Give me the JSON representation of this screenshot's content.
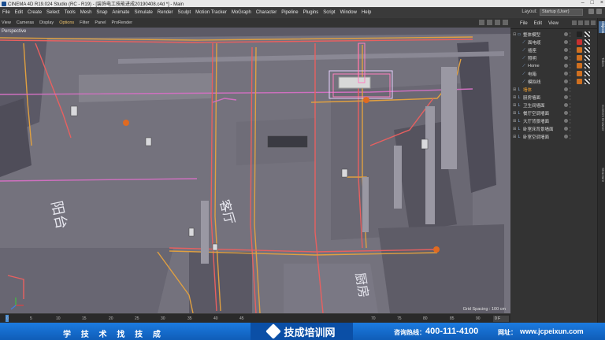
{
  "window": {
    "title": "CINEMA 4D R19.024 Studio (RC - R19) - [装饰电工技能进成20190408.c4d *] - Main"
  },
  "menubar": {
    "items": [
      "File",
      "Edit",
      "Create",
      "Select",
      "Tools",
      "Mesh",
      "Snap",
      "Animate",
      "Simulate",
      "Render",
      "Sculpt",
      "Motion Tracker",
      "MoGraph",
      "Character",
      "Pipeline",
      "Plugins",
      "Script",
      "Window",
      "Help"
    ],
    "layout_label": "Layout:",
    "layout_value": "Startup (User)"
  },
  "viewport_menu": {
    "items": [
      "View",
      "Cameras",
      "Display",
      "Options",
      "Filter",
      "Panel",
      "ProRender"
    ],
    "active": "Options"
  },
  "viewport": {
    "camera_label": "Perspective",
    "grid_spacing": "Grid Spacing : 100 cm",
    "room_labels": [
      "阳台",
      "客厅",
      "厨房"
    ]
  },
  "timeline": {
    "ticks": [
      "0",
      "5",
      "10",
      "15",
      "20",
      "25",
      "30",
      "35",
      "40",
      "45",
      "70",
      "75",
      "80",
      "85",
      "90"
    ],
    "frame": "0 F"
  },
  "object_manager": {
    "menu": [
      "File",
      "Edit",
      "View"
    ],
    "objects": [
      {
        "name": "整体模型",
        "indent": 0,
        "expand": "⊟",
        "icon": "layer-icon",
        "tag": "#222222",
        "tag2": "#e8e8e8"
      },
      {
        "name": "面电缆",
        "indent": 1,
        "expand": "",
        "icon": "spline-icon",
        "tag": "#c83030",
        "tag2": "#e8e8e8"
      },
      {
        "name": "插座",
        "indent": 1,
        "expand": "",
        "icon": "spline-icon",
        "tag": "#d07020",
        "tag2": "#e8e8e8"
      },
      {
        "name": "照明",
        "indent": 1,
        "expand": "",
        "icon": "spline-icon",
        "tag": "#d07020",
        "tag2": "#e8e8e8"
      },
      {
        "name": "Home",
        "indent": 1,
        "expand": "",
        "icon": "spline-icon",
        "tag": "#d07020",
        "tag2": "#e8e8e8"
      },
      {
        "name": "电箱",
        "indent": 1,
        "expand": "",
        "icon": "spline-icon",
        "tag": "#d07020",
        "tag2": "#e8e8e8"
      },
      {
        "name": "模拟线",
        "indent": 1,
        "expand": "",
        "icon": "spline-icon",
        "tag": "#d07020",
        "tag2": "#e8e8e8"
      },
      {
        "name": "墙体",
        "indent": 0,
        "expand": "⊞",
        "icon": "null-icon",
        "tag": "",
        "tag2": "",
        "highlight": true
      },
      {
        "name": "厨房墙面",
        "indent": 0,
        "expand": "⊞",
        "icon": "null-icon",
        "tag": "",
        "tag2": ""
      },
      {
        "name": "卫生间墙面",
        "indent": 0,
        "expand": "⊞",
        "icon": "null-icon",
        "tag": "",
        "tag2": ""
      },
      {
        "name": "餐厅空调墙面",
        "indent": 0,
        "expand": "⊞",
        "icon": "null-icon",
        "tag": "",
        "tag2": ""
      },
      {
        "name": "大厅背景墙面",
        "indent": 0,
        "expand": "⊞",
        "icon": "null-icon",
        "tag": "",
        "tag2": ""
      },
      {
        "name": "卧室床背景墙面",
        "indent": 0,
        "expand": "⊞",
        "icon": "null-icon",
        "tag": "",
        "tag2": ""
      },
      {
        "name": "卧室空调墙面",
        "indent": 0,
        "expand": "⊞",
        "icon": "null-icon",
        "tag": "",
        "tag2": ""
      }
    ]
  },
  "side_tabs": [
    "Objects",
    "Takes",
    "Content Browser",
    "Structure"
  ],
  "banner": {
    "slogan": "学 技 术   找 技 成",
    "brand": "技成培训网",
    "hotline_label": "咨询热线：",
    "hotline": "400-111-4100",
    "site_label": "网址：",
    "site": "www.jcpeixun.com"
  }
}
